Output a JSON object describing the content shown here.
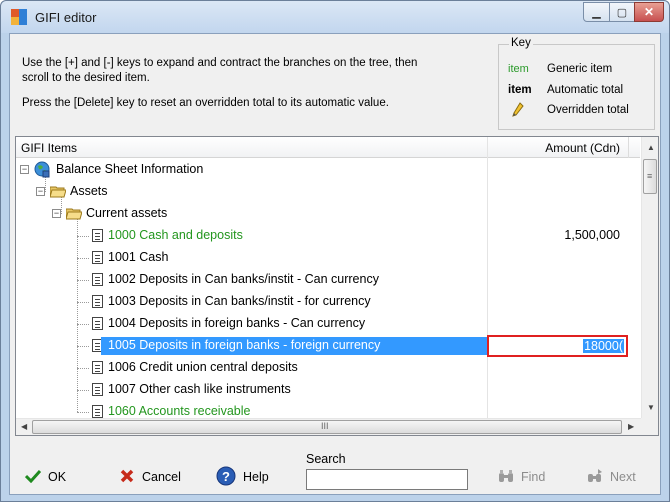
{
  "window": {
    "title": "GIFI editor"
  },
  "instructions": {
    "line1": "Use the [+] and [-] keys to expand and contract the branches on the tree, then",
    "line2": "scroll to the desired item.",
    "line3": "Press the [Delete] key to reset an overridden total to its automatic value."
  },
  "key": {
    "legend": "Key",
    "items": [
      {
        "symbol": "item",
        "style": "green",
        "label": "Generic item"
      },
      {
        "symbol": "item",
        "style": "bold",
        "label": "Automatic total"
      },
      {
        "symbol": "pencil-icon",
        "style": "icon",
        "label": "Overridden total"
      }
    ]
  },
  "grid": {
    "col_items": "GIFI Items",
    "col_amount": "Amount (Cdn)",
    "rows": [
      {
        "label": "Balance Sheet Information",
        "level": 0,
        "type": "root",
        "amount": ""
      },
      {
        "label": "Assets",
        "level": 1,
        "type": "folder",
        "amount": ""
      },
      {
        "label": "Current assets",
        "level": 2,
        "type": "folder",
        "amount": ""
      },
      {
        "label": "1000  Cash and deposits",
        "level": 3,
        "type": "doc",
        "green": true,
        "amount": "1,500,000"
      },
      {
        "label": "1001  Cash",
        "level": 3,
        "type": "doc",
        "amount": ""
      },
      {
        "label": "1002  Deposits in Can banks/instit - Can currency",
        "level": 3,
        "type": "doc",
        "amount": ""
      },
      {
        "label": "1003  Deposits in Can banks/instit - for currency",
        "level": 3,
        "type": "doc",
        "amount": ""
      },
      {
        "label": "1004  Deposits in foreign banks - Can currency",
        "level": 3,
        "type": "doc",
        "amount": ""
      },
      {
        "label": "1005  Deposits in foreign banks - foreign currency",
        "level": 3,
        "type": "doc",
        "selected": true,
        "amount": "18000("
      },
      {
        "label": "1006  Credit union central deposits",
        "level": 3,
        "type": "doc",
        "amount": ""
      },
      {
        "label": "1007  Other cash like instruments",
        "level": 3,
        "type": "doc",
        "amount": ""
      },
      {
        "label": "1060  Accounts receivable",
        "level": 3,
        "type": "doc",
        "green": true,
        "amount": ""
      }
    ]
  },
  "scroll": {
    "h_thumb_label": "III"
  },
  "bottom": {
    "ok": "OK",
    "cancel": "Cancel",
    "help": "Help",
    "search_label": "Search",
    "search_value": "",
    "find": "Find",
    "next": "Next"
  }
}
